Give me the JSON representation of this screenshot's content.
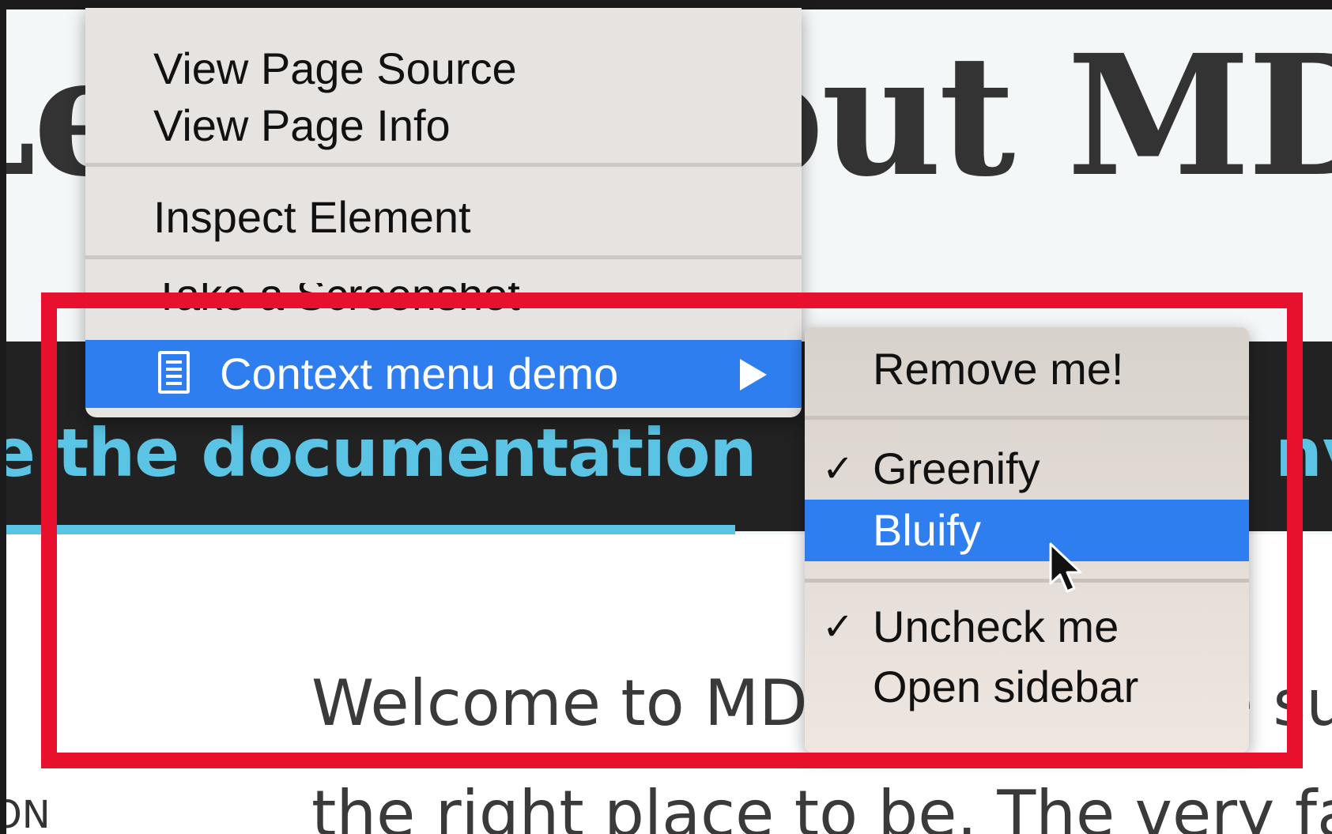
{
  "page": {
    "hero_title": "Learn about MDN",
    "doc_link": "e the documentation",
    "doc_link_right": "nve",
    "intro_line1": "Welcome to MDN! If you have sug",
    "intro_line2": "the right place to be. The very fac",
    "side_label": "ON"
  },
  "context_menu": {
    "view_source": "View Page Source",
    "view_info": "View Page Info",
    "inspect": "Inspect Element",
    "screenshot": "Take a Screenshot",
    "demo": "Context menu demo",
    "demo_icon": "document-icon"
  },
  "submenu": {
    "remove": "Remove me!",
    "greenify": "Greenify",
    "greenify_check": "✓",
    "bluify": "Bluify",
    "uncheck": "Uncheck me",
    "uncheck_check": "✓",
    "sidebar": "Open sidebar"
  },
  "colors": {
    "highlight": "#2f7ef0",
    "annotation_frame": "#e8112d",
    "link": "#5bc3e3"
  }
}
